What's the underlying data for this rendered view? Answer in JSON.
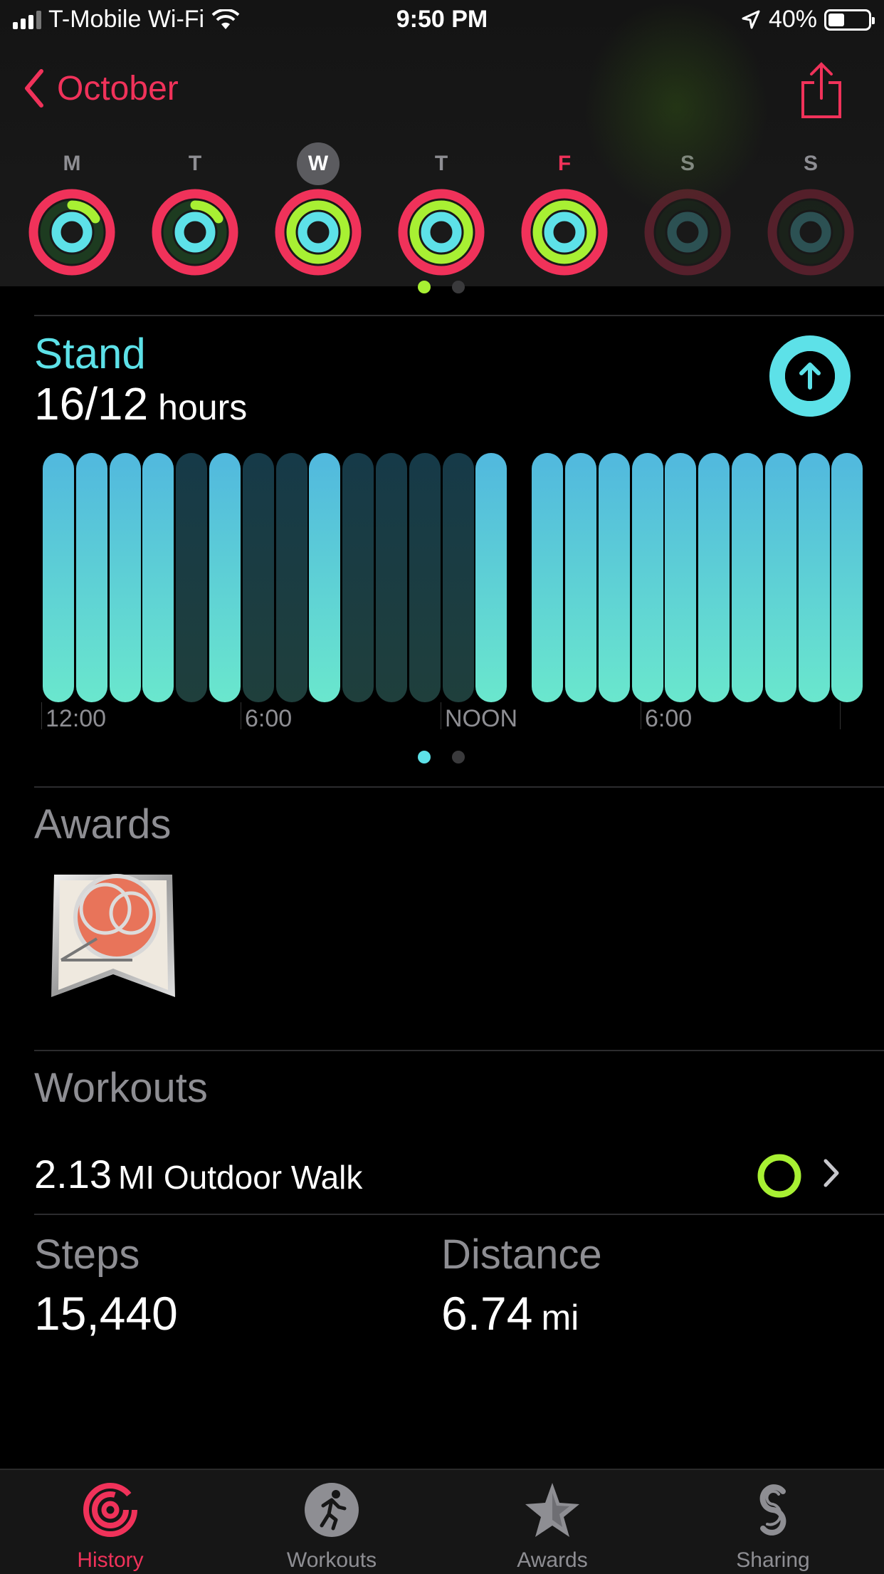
{
  "status_bar": {
    "carrier": "T-Mobile Wi-Fi",
    "time": "9:50 PM",
    "battery": "40%",
    "battery_level": 0.4
  },
  "nav": {
    "back_label": "October",
    "share_icon": "share-icon"
  },
  "week": [
    {
      "letter": "M",
      "state": "past"
    },
    {
      "letter": "T",
      "state": "past"
    },
    {
      "letter": "W",
      "state": "selected"
    },
    {
      "letter": "T",
      "state": "past"
    },
    {
      "letter": "F",
      "state": "today"
    },
    {
      "letter": "S",
      "state": "future"
    },
    {
      "letter": "S",
      "state": "future"
    }
  ],
  "stand": {
    "title": "Stand",
    "value": "16/12",
    "unit": "hours",
    "hours_stood": [
      1,
      1,
      1,
      1,
      0,
      1,
      0,
      0,
      1,
      0,
      0,
      0,
      0,
      1,
      1,
      1,
      1,
      1,
      1,
      1,
      1,
      1,
      1,
      1
    ],
    "axis_labels": [
      "12:00",
      "6:00",
      "NOON",
      "6:00"
    ]
  },
  "awards": {
    "title": "Awards"
  },
  "workouts": {
    "title": "Workouts",
    "item": {
      "distance": "2.13",
      "label": "MI Outdoor Walk"
    }
  },
  "stats": {
    "steps_label": "Steps",
    "steps_value": "15,440",
    "distance_label": "Distance",
    "distance_value": "6.74",
    "distance_unit": "mi"
  },
  "tabs": [
    {
      "label": "History",
      "icon": "history-icon",
      "active": true
    },
    {
      "label": "Workouts",
      "icon": "workouts-icon",
      "active": false
    },
    {
      "label": "Awards",
      "icon": "awards-icon",
      "active": false
    },
    {
      "label": "Sharing",
      "icon": "sharing-icon",
      "active": false
    }
  ],
  "colors": {
    "accent_red": "#f0325a",
    "move": "#f0325a",
    "exercise": "#a8f033",
    "stand": "#5de1e8"
  }
}
